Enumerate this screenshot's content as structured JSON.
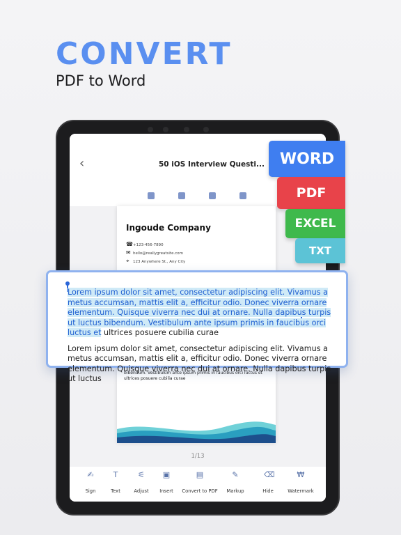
{
  "hero": {
    "headline": "CONVERT",
    "subline": "PDF to Word"
  },
  "colors": {
    "accent": "#5a8ff0",
    "word": "#3f7ef0",
    "pdf": "#e8434a",
    "excel": "#3fb94c",
    "txt": "#5cc3d6",
    "highlight": "#cfeaf7"
  },
  "app": {
    "back_icon": "chevron-left-icon",
    "doc_title": "50 iOS Interview Questi...",
    "toolbar_icons": [
      "checklist-icon",
      "folder-add-icon",
      "lock-icon",
      "scan-icon"
    ],
    "page_counter": "1/13"
  },
  "document": {
    "company": "Ingoude Company",
    "phone": "+123-456-7890",
    "email": "hello@reallygreatsite.com",
    "address": "123 Anywhere St., Any City",
    "body_text": "bibendum. Vestibulum ante ipsum primis in faucibus orci luctus et ultrices posuere cubilia curae"
  },
  "formats": [
    "WORD",
    "PDF",
    "EXCEL",
    "TXT"
  ],
  "zoom": {
    "highlighted": "Lorem ipsum dolor sit amet, consectetur adipiscing elit. Vivamus a metus accumsan, mattis elit a, efficitur odio. Donec viverra ornare elementum. Quisque viverra nec dui at ornare. Nulla dapibus turpis ut luctus bibendum. Vestibulum ante ipsum primis in faucibus orci luctus et",
    "after_highlight": " ultrices posuere cubilia curae",
    "paragraph2": "Lorem ipsum dolor sit amet, consectetur adipiscing elit. Vivamus a metus accumsan, mattis elit a, efficitur odio. Donec viverra ornare elementum. Quisque viverra nec dui at ornare. Nulla dapibus turpis ut luctus"
  },
  "bottom_toolbar": [
    {
      "label": "Sign",
      "icon": "signature-icon",
      "glyph": "✍"
    },
    {
      "label": "Text",
      "icon": "text-icon",
      "glyph": "T"
    },
    {
      "label": "Adjust",
      "icon": "adjust-icon",
      "glyph": "⚟"
    },
    {
      "label": "Insert",
      "icon": "insert-image-icon",
      "glyph": "▣"
    },
    {
      "label": "Convert to PDF",
      "icon": "convert-icon",
      "glyph": "▤"
    },
    {
      "label": "Markup",
      "icon": "pen-icon",
      "glyph": "✎"
    },
    {
      "label": "Hide",
      "icon": "eraser-icon",
      "glyph": "⌫"
    },
    {
      "label": "Watermark",
      "icon": "watermark-icon",
      "glyph": "₩"
    }
  ]
}
